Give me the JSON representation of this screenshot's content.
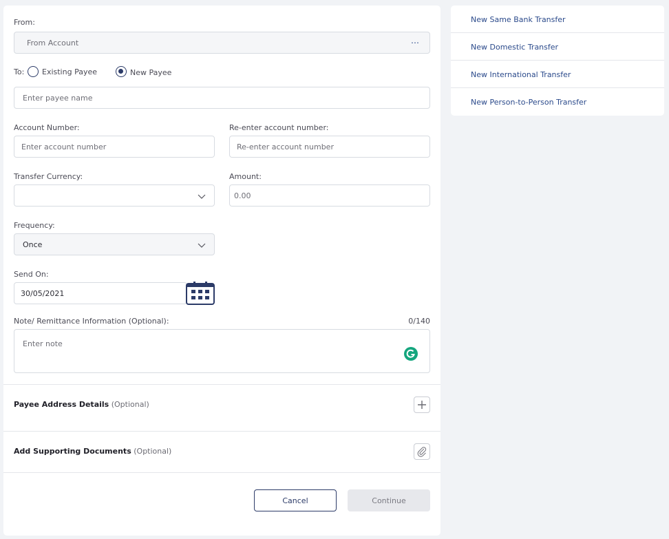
{
  "form": {
    "from_label": "From:",
    "from_account_placeholder": "From Account",
    "from_more_icon": "ellipsis-icon",
    "to_label": "To:",
    "payee_options": [
      {
        "label": "Existing Payee",
        "selected": false
      },
      {
        "label": "New Payee",
        "selected": true
      }
    ],
    "payee_name_placeholder": "Enter payee name",
    "account_number_label": "Account Number:",
    "account_number_placeholder": "Enter account number",
    "reenter_label": "Re-enter account number:",
    "reenter_placeholder": "Re-enter account number",
    "currency_label": "Transfer Currency:",
    "currency_value": "",
    "amount_label": "Amount:",
    "amount_value": "0.00",
    "frequency_label": "Frequency:",
    "frequency_value": "Once",
    "send_on_label": "Send On:",
    "send_on_value": "30/05/2021",
    "note_label": "Note/ Remittance Information (Optional):",
    "note_counter": "0/140",
    "note_placeholder": "Enter note",
    "payee_address_title": "Payee Address Details",
    "payee_address_optional": "(Optional)",
    "supporting_docs_title": "Add Supporting Documents",
    "supporting_docs_optional": "(Optional)",
    "cancel_label": "Cancel",
    "continue_label": "Continue"
  },
  "quick_links": [
    "New Same Bank Transfer",
    "New Domestic Transfer",
    "New International Transfer",
    "New Person-to-Person Transfer"
  ],
  "colors": {
    "primary": "#2b3a67",
    "link": "#2b4a8b",
    "grammarly": "#15a67e",
    "background": "#f1f3f6"
  }
}
